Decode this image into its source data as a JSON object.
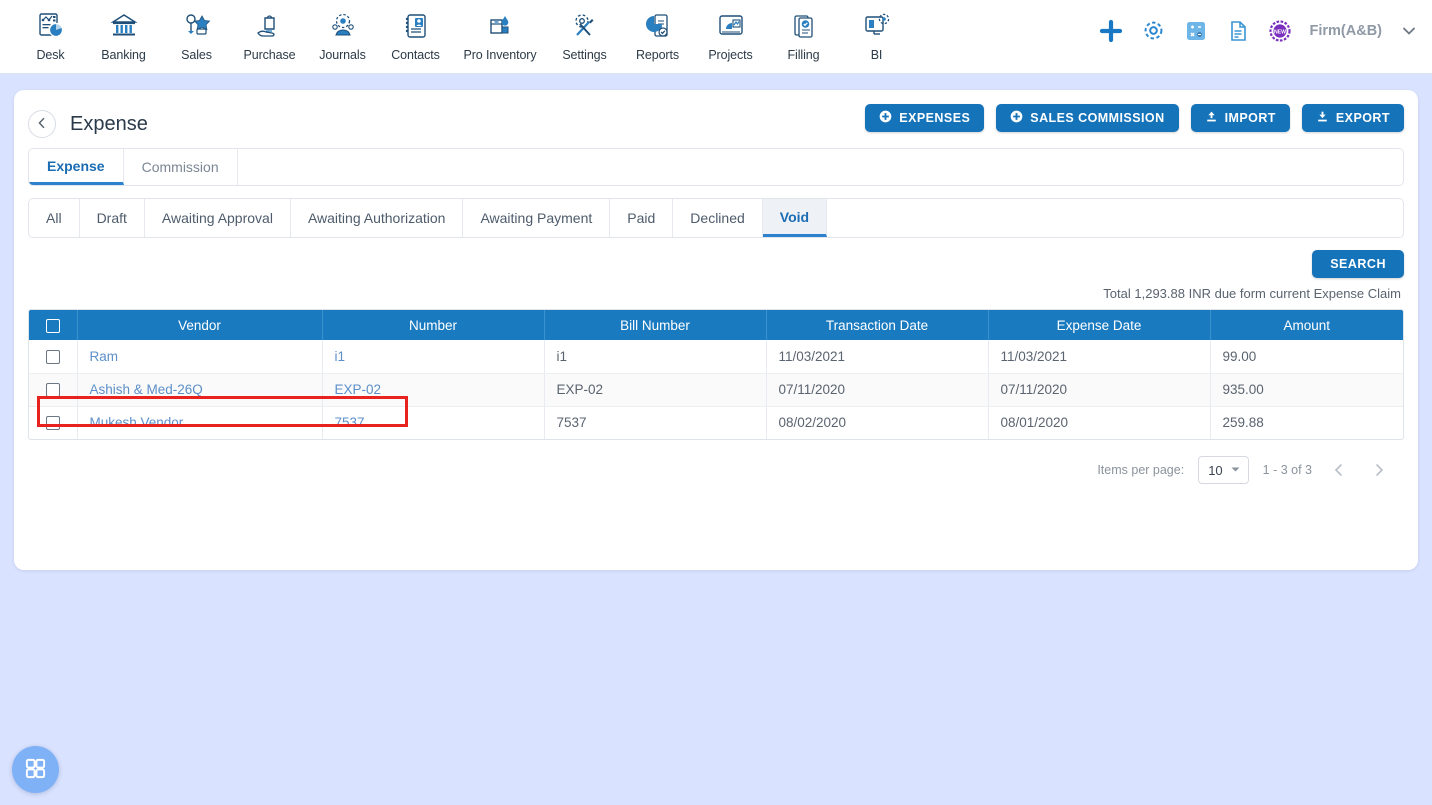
{
  "topnav": {
    "items": [
      {
        "label": "Desk",
        "icon": "desk-dashboard-icon"
      },
      {
        "label": "Banking",
        "icon": "bank-building-icon"
      },
      {
        "label": "Sales",
        "icon": "sales-tag-icon"
      },
      {
        "label": "Purchase",
        "icon": "purchase-hand-bag-icon"
      },
      {
        "label": "Journals",
        "icon": "journals-people-gear-icon"
      },
      {
        "label": "Contacts",
        "icon": "contacts-book-icon"
      },
      {
        "label": "Pro Inventory",
        "icon": "inventory-box-icon"
      },
      {
        "label": "Settings",
        "icon": "settings-tools-icon"
      },
      {
        "label": "Reports",
        "icon": "reports-pie-doc-icon"
      },
      {
        "label": "Projects",
        "icon": "projects-board-icon"
      },
      {
        "label": "Filling",
        "icon": "filling-docs-check-icon"
      },
      {
        "label": "BI",
        "icon": "bi-monitor-gear-icon"
      }
    ],
    "right": {
      "add_icon": "plus-icon",
      "settings_icon": "gear-icon",
      "calculator_icon": "calculator-icon",
      "notes_icon": "document-icon",
      "new_badge_icon": "new-badge-icon",
      "firm_label": "Firm(A&B)",
      "chevron_icon": "chevron-down-icon"
    }
  },
  "card": {
    "back_icon": "chevron-left-icon",
    "title": "Expense",
    "actions": [
      {
        "label": "EXPENSES",
        "icon": "plus-circle-icon"
      },
      {
        "label": "SALES COMMISSION",
        "icon": "plus-circle-icon"
      },
      {
        "label": "IMPORT",
        "icon": "upload-icon"
      },
      {
        "label": "EXPORT",
        "icon": "download-icon"
      }
    ],
    "subtabs": [
      {
        "label": "Expense",
        "active": true
      },
      {
        "label": "Commission",
        "active": false
      }
    ],
    "filters": [
      {
        "label": "All",
        "active": false
      },
      {
        "label": "Draft",
        "active": false
      },
      {
        "label": "Awaiting Approval",
        "active": false
      },
      {
        "label": "Awaiting Authorization",
        "active": false
      },
      {
        "label": "Awaiting Payment",
        "active": false
      },
      {
        "label": "Paid",
        "active": false
      },
      {
        "label": "Declined",
        "active": false
      },
      {
        "label": "Void",
        "active": true
      }
    ],
    "search_label": "SEARCH",
    "total_text": "Total 1,293.88 INR due form current Expense Claim"
  },
  "table": {
    "columns": [
      "Vendor",
      "Number",
      "Bill Number",
      "Transaction Date",
      "Expense Date",
      "Amount"
    ],
    "rows": [
      {
        "vendor": "Ram",
        "number": "i1",
        "bill_number": "i1",
        "transaction_date": "11/03/2021",
        "expense_date": "11/03/2021",
        "amount": "99.00"
      },
      {
        "vendor": "Ashish & Med-26Q",
        "number": "EXP-02",
        "bill_number": "EXP-02",
        "transaction_date": "07/11/2020",
        "expense_date": "07/11/2020",
        "amount": "935.00"
      },
      {
        "vendor": "Mukesh Vendor",
        "number": "7537",
        "bill_number": "7537",
        "transaction_date": "08/02/2020",
        "expense_date": "08/01/2020",
        "amount": "259.88"
      }
    ]
  },
  "paginator": {
    "items_per_page_label": "Items per page:",
    "items_per_page_value": "10",
    "range_label": "1 - 3 of 3",
    "prev_icon": "chevron-left-icon",
    "next_icon": "chevron-right-icon"
  },
  "fab": {
    "icon": "apps-grid-icon"
  },
  "colors": {
    "page_background": "#d9e2fe",
    "primary_blue": "#1573b9",
    "table_header_blue": "#1a7ac0",
    "link_blue": "#5d8fc9",
    "highlight_red": "#e8231f",
    "fab_blue": "#7fb1f6"
  }
}
